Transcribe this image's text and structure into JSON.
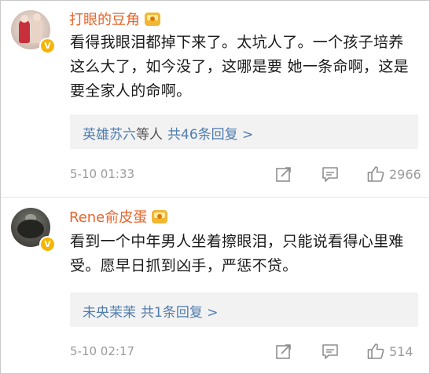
{
  "comments": [
    {
      "username": "打眼的豆角",
      "verified_badge": "V",
      "body": "看得我眼泪都掉下来了。太坑人了。一个孩子培养这么大了，如今没了，这哪是要 她一条命啊，这是要全家人的命啊。",
      "reply": {
        "names": "英雄苏六",
        "etc": "等人",
        "count": "共46条回复 >"
      },
      "time": "5-10 01:33",
      "likes": "2966"
    },
    {
      "username": "Rene俞皮蛋",
      "verified_badge": "V",
      "body": "看到一个中年男人坐着擦眼泪，只能说看得心里难受。愿早日抓到凶手，严惩不贷。",
      "reply": {
        "names": "未央茉茉",
        "etc": "",
        "count": "共1条回复 >"
      },
      "time": "5-10 02:17",
      "likes": "514"
    }
  ],
  "colors": {
    "username": "#e8642a",
    "link": "#507daf",
    "muted": "#9a9a9a",
    "badge": "#f5b500",
    "reply_bg": "#f2f2f2"
  },
  "icons": [
    "crown-badge-icon",
    "verified-v-icon",
    "share-icon",
    "comment-icon",
    "thumbs-up-icon"
  ]
}
